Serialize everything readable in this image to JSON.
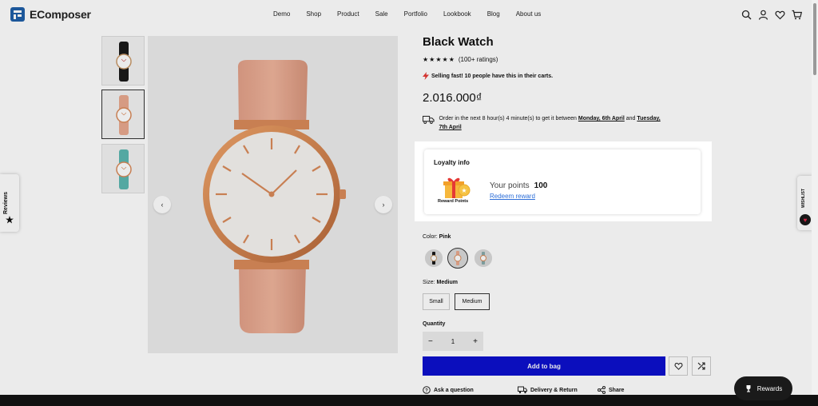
{
  "brand": {
    "name": "EComposer"
  },
  "nav": {
    "items": [
      "Demo",
      "Shop",
      "Product",
      "Sale",
      "Portfolio",
      "Lookbook",
      "Blog",
      "About us"
    ]
  },
  "header_icons": [
    "search-icon",
    "user-icon",
    "heart-icon",
    "cart-icon"
  ],
  "product": {
    "title": "Black Watch",
    "stars": "★★★★★",
    "ratings_text": "(100+ ratings)",
    "selling_fast": "Selling fast! 10 people have this in their carts.",
    "price": "2.016.000₫",
    "delivery_prefix": "Order in the next 8 hour(s) 4 minute(s) to get it between ",
    "delivery_start": "Monday, 6th April",
    "delivery_and": " and ",
    "delivery_end": "Tuesday, 7th April"
  },
  "loyalty": {
    "title": "Loyalty info",
    "reward_points_label": "Reward Points",
    "your_points_label": "Your points",
    "points_value": "100",
    "redeem_link": "Redeem reward"
  },
  "options": {
    "color_label": "Color:",
    "color_value": "Pink",
    "size_label": "Size:",
    "size_value": "Medium",
    "sizes": [
      "Small",
      "Medium"
    ],
    "quantity_label": "Quantity",
    "quantity_value": "1",
    "minus": "−",
    "plus": "+"
  },
  "actions": {
    "add_to_bag": "Add to bag",
    "ask_question": "Ask a question",
    "delivery_return": "Delivery & Return",
    "share": "Share"
  },
  "side_tabs": {
    "reviews": "Reviews",
    "wishlist": "WISHLIST"
  },
  "rewards_button": "Rewards",
  "gallery": {
    "prev": "‹",
    "next": "›"
  },
  "colors": {
    "accent": "#0d10ce",
    "link": "#2d6ed8",
    "strap_pink": "#e9a98f",
    "case_rose_gold": "#d98a5a"
  }
}
